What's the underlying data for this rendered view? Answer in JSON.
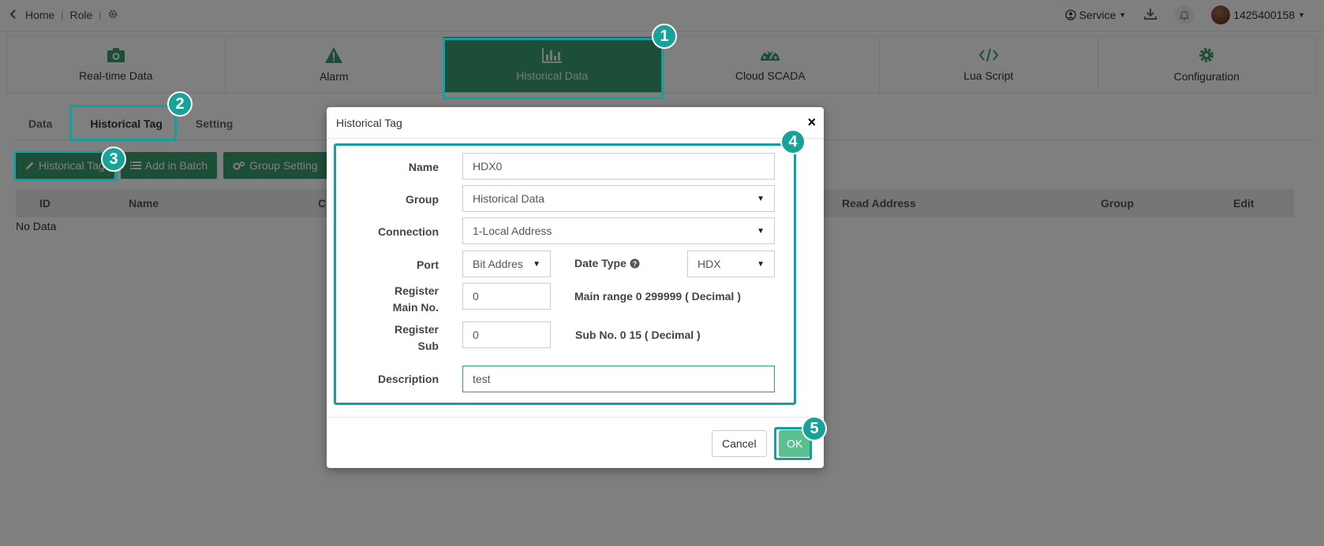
{
  "topbar": {
    "home": "Home",
    "role": "Role",
    "service": "Service",
    "username": "1425400158"
  },
  "modules": [
    {
      "label": "Real-time Data"
    },
    {
      "label": "Alarm"
    },
    {
      "label": "Historical Data"
    },
    {
      "label": "Cloud SCADA"
    },
    {
      "label": "Lua Script"
    },
    {
      "label": "Configuration"
    }
  ],
  "subtabs": [
    "Data",
    "Historical Tag",
    "Setting"
  ],
  "actions": {
    "historical_tag": "Historical Tag",
    "add_in_batch": "Add in Batch",
    "group_setting": "Group Setting"
  },
  "table": {
    "columns": {
      "id": "ID",
      "name": "Name",
      "conn": "C",
      "read_address": "Read Address",
      "group": "Group",
      "edit": "Edit"
    },
    "empty": "No Data"
  },
  "modal": {
    "title": "Historical Tag",
    "name_label": "Name",
    "name_value": "HDX0",
    "group_label": "Group",
    "group_value": "Historical Data",
    "connection_label": "Connection",
    "connection_value": "1-Local Address",
    "port_label": "Port",
    "port_value": "Bit Addres",
    "date_type_label": "Date Type",
    "date_type_value": "HDX",
    "reg_main_label_1": "Register",
    "reg_main_label_2": "Main No.",
    "reg_main_value": "0",
    "main_range": "Main range 0 299999 ( Decimal )",
    "reg_sub_label_1": "Register",
    "reg_sub_label_2": "Sub",
    "reg_sub_value": "0",
    "sub_range": "Sub No. 0 15 ( Decimal )",
    "description_label": "Description",
    "description_value": "test",
    "cancel": "Cancel",
    "ok": "OK"
  },
  "callouts": [
    "1",
    "2",
    "3",
    "4",
    "5"
  ],
  "colors": {
    "accent": "#3b9d6e",
    "callout": "#17a29a"
  }
}
